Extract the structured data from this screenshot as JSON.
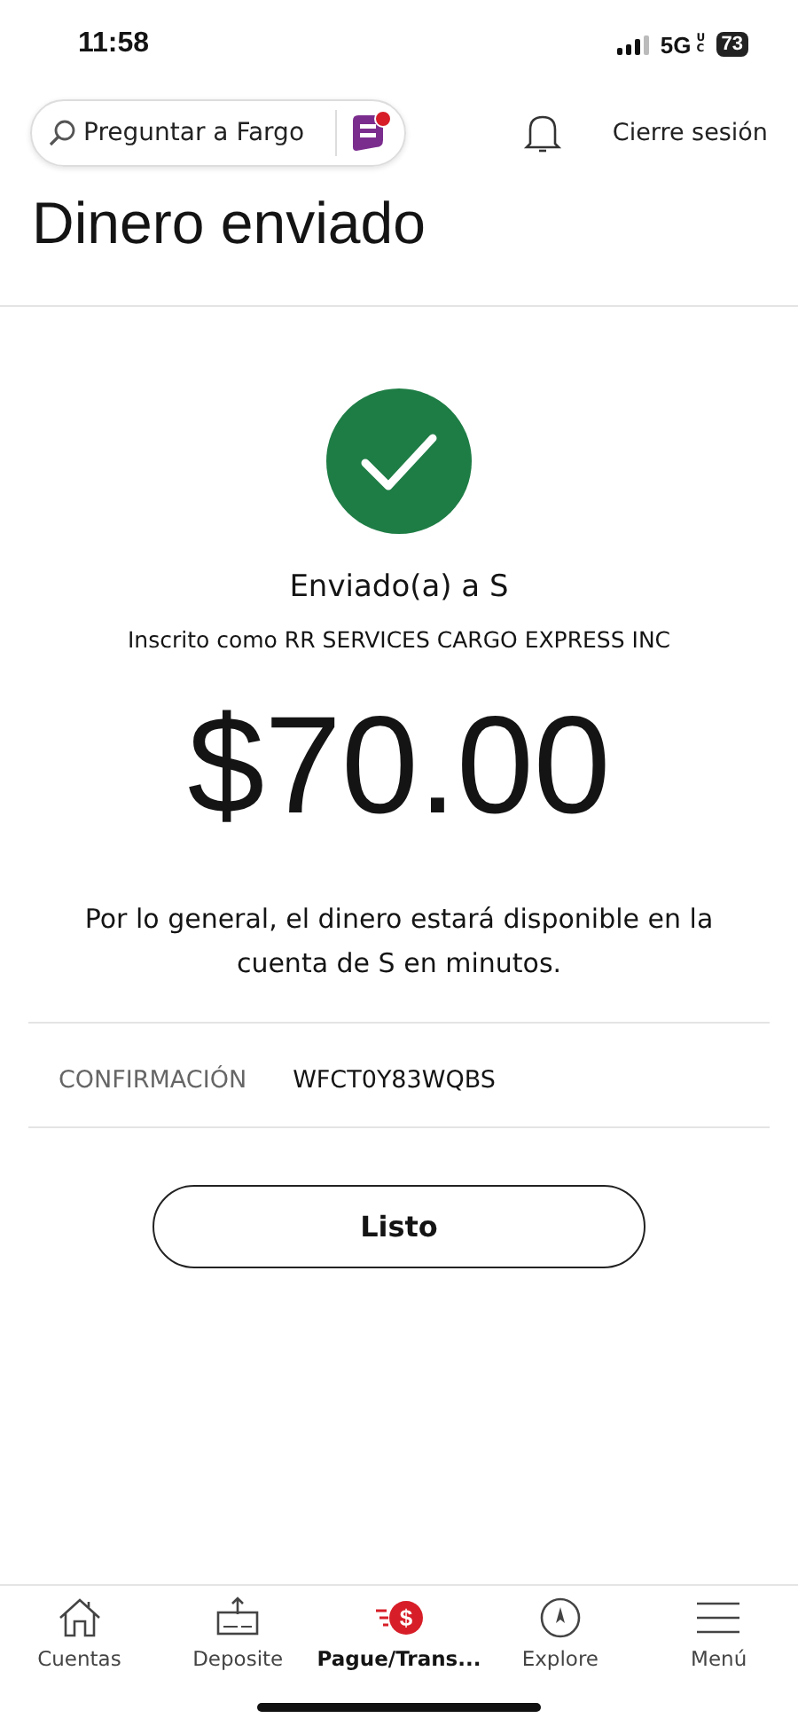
{
  "status_bar": {
    "time": "11:58",
    "network": "5G",
    "network_suffix": "UC",
    "battery": "73"
  },
  "top_bar": {
    "search": {
      "placeholder": "Preguntar a Fargo"
    },
    "logout": "Cierre sesión"
  },
  "title": "Dinero enviado",
  "confirmation": {
    "recipient": "Enviado(a) a S",
    "enrolled": "Inscrito como RR SERVICES CARGO EXPRESS INC",
    "amount": "$70.00",
    "message": "Por lo general, el dinero estará disponible en la cuenta de S en minutos.",
    "label": "CONFIRMACIÓN",
    "code": "WFCT0Y83WQBS"
  },
  "button": "Listo",
  "nav": [
    {
      "kind": "home",
      "label": "Cuentas",
      "selected": false
    },
    {
      "kind": "deposit",
      "label": "Deposite",
      "selected": false
    },
    {
      "kind": "pay",
      "icon_text": "$",
      "label": "Pague/Trans...",
      "selected": true
    },
    {
      "kind": "explore",
      "label": "Explore",
      "selected": false
    },
    {
      "kind": "menu",
      "label": "Menú",
      "selected": false
    }
  ]
}
